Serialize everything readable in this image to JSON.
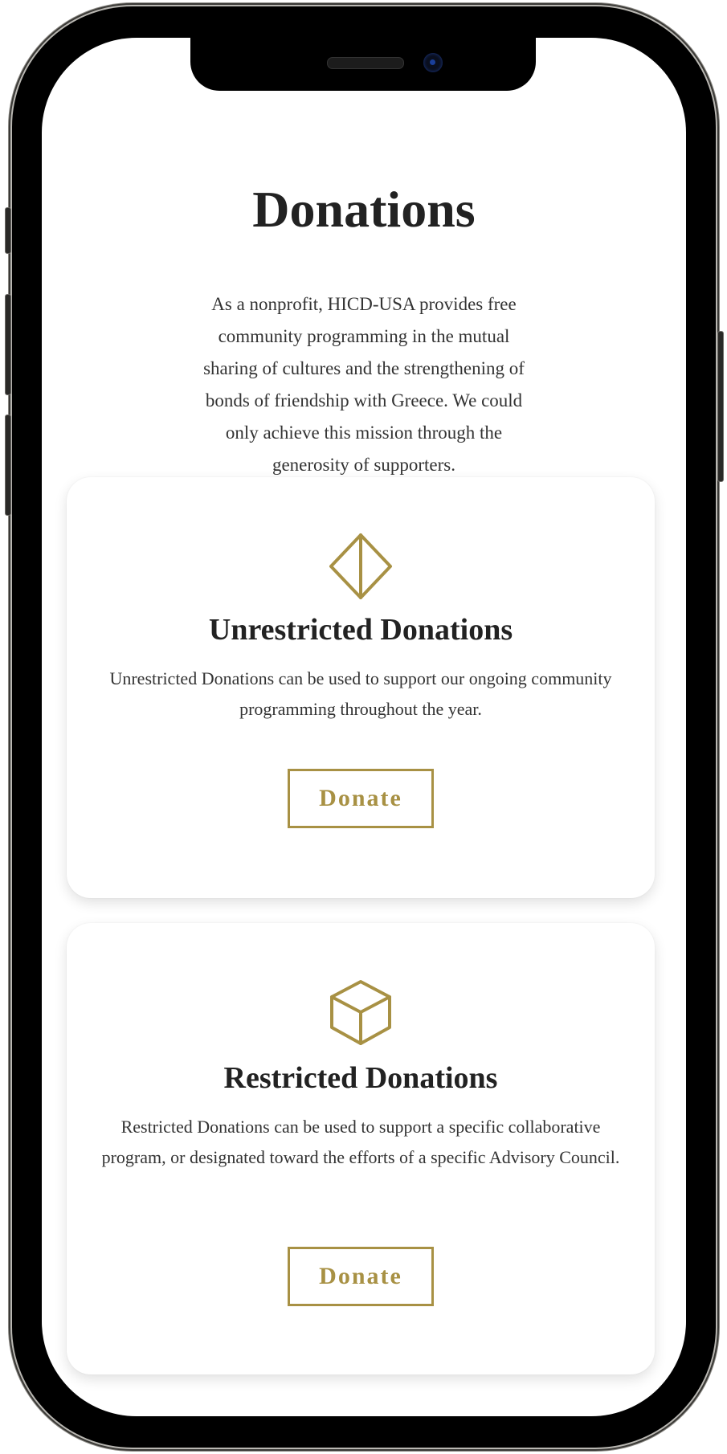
{
  "page": {
    "title": "Donations",
    "intro": "As a nonprofit, HICD-USA provides free community programming in the mutual sharing of cultures and the strengthening of bonds of friendship with Greece. We could only achieve this mission through the generosity of supporters."
  },
  "cards": [
    {
      "icon": "pyramid-icon",
      "title": "Unrestricted Donations",
      "text": "Unrestricted Donations can be used to support our ongoing community programming throughout the year.",
      "button_label": "Donate"
    },
    {
      "icon": "cube-icon",
      "title": "Restricted Donations",
      "text": "Restricted Donations can be used to support a specific collaborative program, or designated toward the efforts of a specific Advisory Council.",
      "button_label": "Donate"
    }
  ],
  "colors": {
    "accent": "#a89144",
    "text": "#2b2b2b",
    "background": "#ffffff"
  }
}
